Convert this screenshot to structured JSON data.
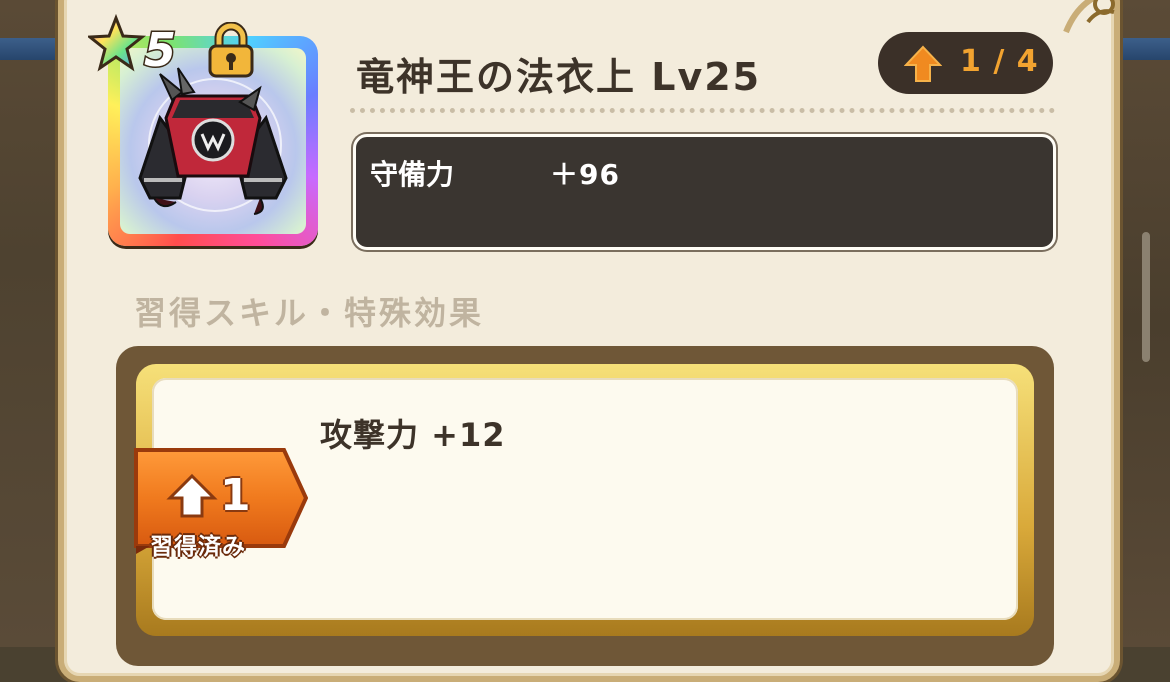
{
  "item": {
    "rarity": "5",
    "name": "竜神王の法衣上 Lv25",
    "upgrade": "1 / 4",
    "icon": "dark-robe-armor-icon"
  },
  "stats": {
    "label": "守備力",
    "value": "＋96"
  },
  "skills": {
    "heading": "習得スキル・特殊効果",
    "entries": [
      {
        "level": "1",
        "status": "習得済み",
        "effect": "攻撃力 +12"
      }
    ]
  },
  "colors": {
    "accent_orange": "#f2a330",
    "panel": "#f3ecdc",
    "dark": "#3a3530"
  }
}
